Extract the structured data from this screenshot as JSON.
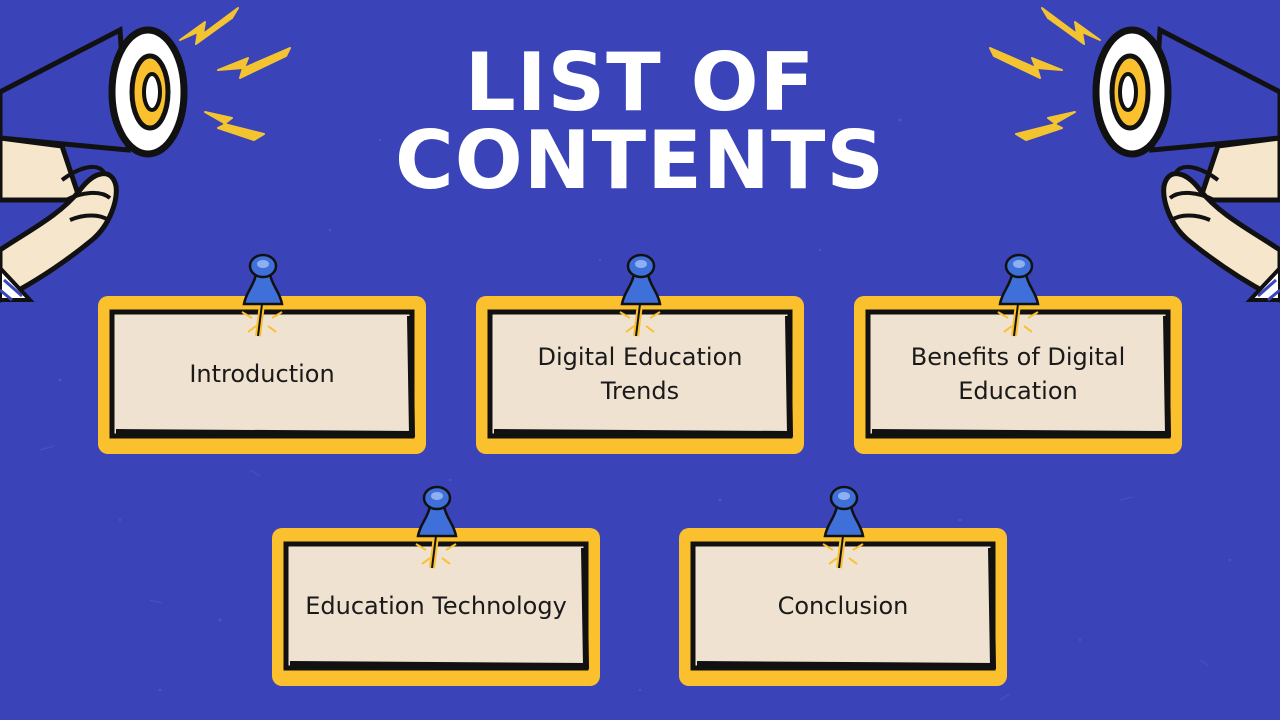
{
  "slide": {
    "title_line1": "LIST OF",
    "title_line2": "CONTENTS"
  },
  "cards": [
    {
      "label": "Introduction"
    },
    {
      "label": "Digital Education Trends"
    },
    {
      "label": "Benefits of Digital Education"
    },
    {
      "label": "Education Technology"
    },
    {
      "label": "Conclusion"
    }
  ],
  "colors": {
    "background": "#3a43b8",
    "card_fill": "#efe2d0",
    "card_border": "#fbc02d",
    "pin": "#3f6fd8",
    "bolt": "#f4c430"
  },
  "icons": [
    "megaphone-icon",
    "lightning-bolt-icon",
    "pushpin-icon"
  ]
}
